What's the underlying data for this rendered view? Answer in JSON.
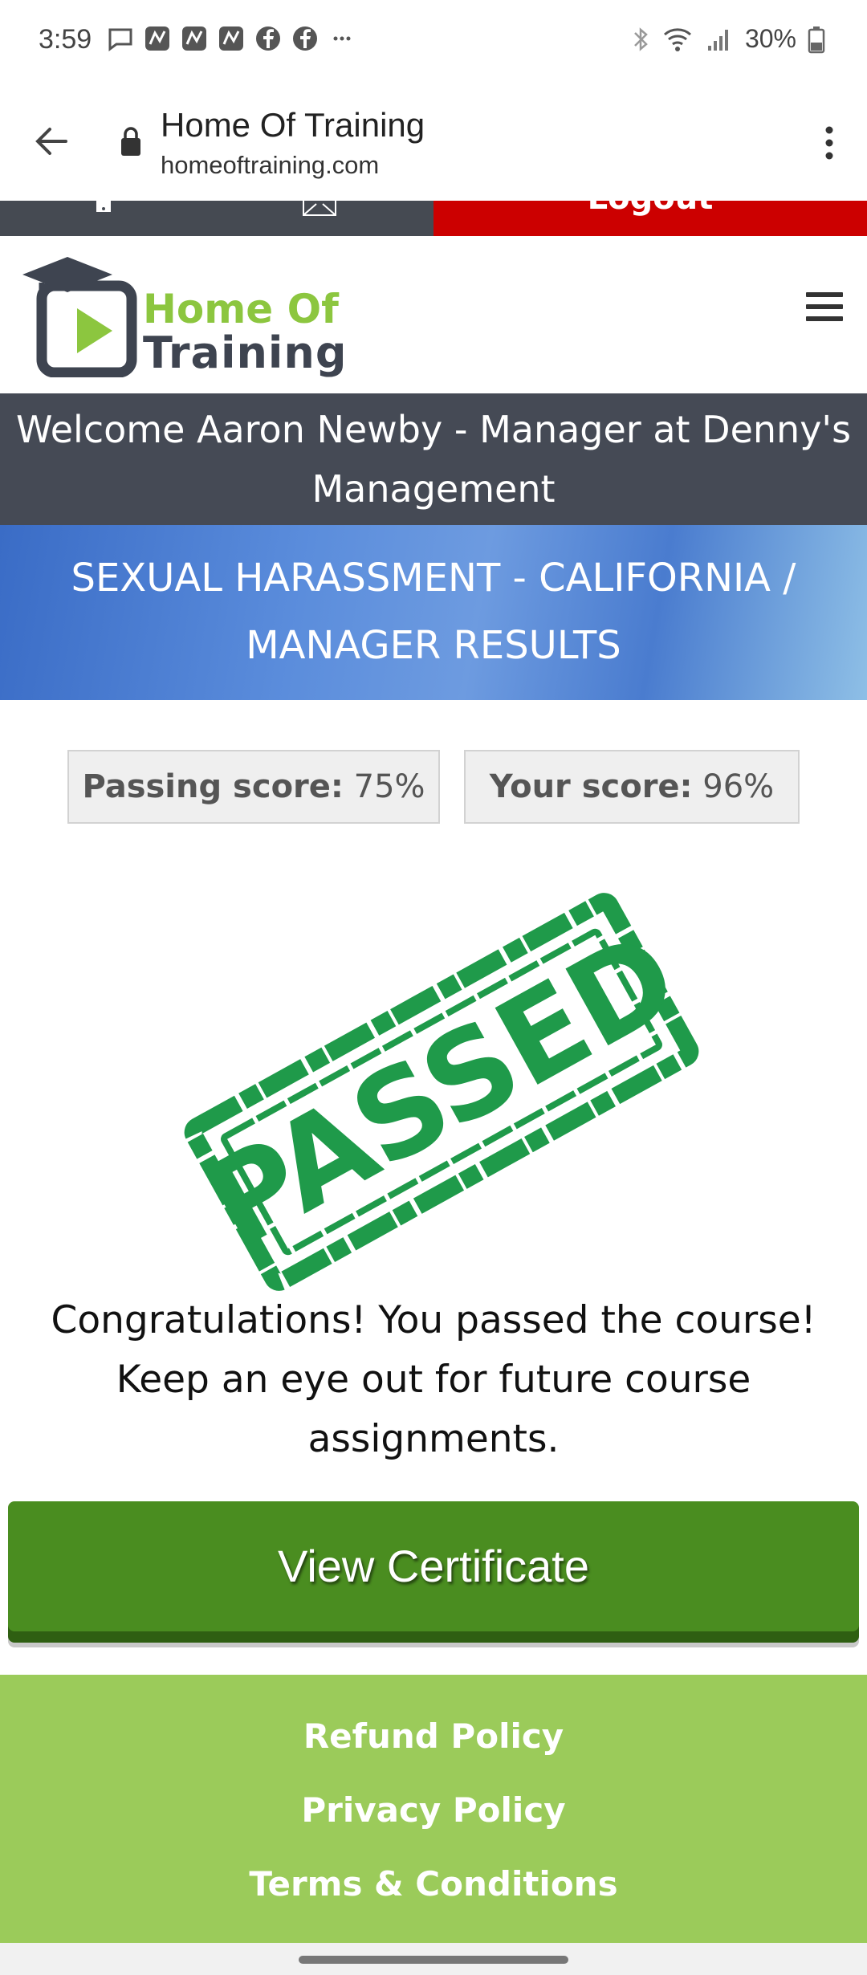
{
  "status_bar": {
    "time": "3:59",
    "battery": "30%",
    "left_icons": [
      "message-icon",
      "app-icon",
      "app-icon",
      "app-icon",
      "facebook-icon",
      "facebook-icon",
      "more-icon"
    ],
    "right_icons": [
      "bluetooth-icon",
      "wifi-icon",
      "signal-icon",
      "battery-icon"
    ]
  },
  "browser": {
    "title": "Home Of Training",
    "url": "homeoftraining.com"
  },
  "top_strip": {
    "logout_label": "Logout"
  },
  "logo": {
    "line1": "Home Of",
    "line2": "Training"
  },
  "welcome": {
    "text": "Welcome Aaron Newby - Manager at Denny's Management"
  },
  "course": {
    "title": "SEXUAL HARASSMENT - CALIFORNIA / MANAGER RESULTS"
  },
  "scores": {
    "passing_label": "Passing score:",
    "passing_value": "75%",
    "yours_label": "Your score:",
    "yours_value": "96%"
  },
  "stamp": {
    "text": "PASSED"
  },
  "message": {
    "text": "Congratulations! You passed the course! Keep an eye out for future course assignments."
  },
  "certificate_button": {
    "label": "View Certificate"
  },
  "footer": {
    "links": [
      "Refund Policy",
      "Privacy Policy",
      "Terms & Conditions"
    ]
  },
  "colors": {
    "brand_green": "#8cc63f",
    "brand_dark": "#454a55",
    "logout_red": "#cc0000",
    "button_green": "#4a8d20",
    "footer_green": "#9bcb5a",
    "stamp_green": "#1f9a4a"
  }
}
